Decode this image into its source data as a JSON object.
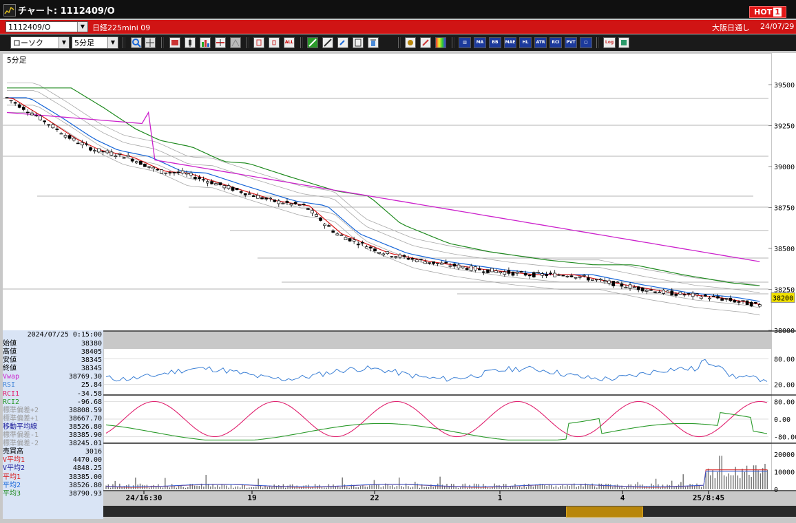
{
  "window": {
    "title": "チャート: 1112409/O",
    "hot_label": "HOT",
    "hot_num": "1"
  },
  "symbolbar": {
    "code": "1112409/O",
    "name": "日経225mini 09",
    "market": "大阪日通し",
    "date": "24/07/29"
  },
  "toolbar": {
    "chart_type": "ローソク",
    "period": "5分足",
    "labels": [
      "MA",
      "BB",
      "MAE",
      "HL",
      "ATR",
      "RCI",
      "PVT",
      "Log"
    ]
  },
  "chart": {
    "period_label": "5分足",
    "price_axis": [
      "39500",
      "39250",
      "39000",
      "38750",
      "38500",
      "38250",
      "38000"
    ],
    "current_price_badge": "38200",
    "rsi_axis": [
      "80.00",
      "20.00"
    ],
    "rci_axis": [
      "80.00",
      "0.00",
      "-80.00"
    ],
    "vol_axis": [
      "20000",
      "10000",
      "0"
    ],
    "x_labels": [
      "24/16:30",
      "19",
      "22",
      "1",
      "4",
      "25/8:45"
    ],
    "colors": {
      "bg": "#ffffff",
      "ma1": "#d81818",
      "ma2": "#1565d8",
      "ma3": "#1f8a1f",
      "vwap": "#cc22cc",
      "band": "#a8a8a8",
      "rsi": "#3a7fd5",
      "rci1": "#e0206e",
      "rci2": "#2a9a2a",
      "vol_bar": "#707070",
      "vol_ma1": "#d81818",
      "vol_ma2": "#2a5ad8"
    }
  },
  "info_panel": {
    "timestamp": "2024/07/25 0:15:00",
    "rows": [
      {
        "label": "始値",
        "value": "38380",
        "color": "#000000"
      },
      {
        "label": "高値",
        "value": "38405",
        "color": "#000000"
      },
      {
        "label": "安値",
        "value": "38345",
        "color": "#000000"
      },
      {
        "label": "終値",
        "value": "38345",
        "color": "#000000"
      },
      {
        "label": "Vwap",
        "value": "38769.30",
        "color": "#cc22cc"
      },
      {
        "label": "RSI",
        "value": "25.84",
        "color": "#4a8ad8"
      },
      {
        "label": "RCI1",
        "value": "-34.58",
        "color": "#e0206e"
      },
      {
        "label": "RCI2",
        "value": "-96.68",
        "color": "#2a9a2a"
      },
      {
        "label": "標準偏差+2",
        "value": "38808.59",
        "color": "#9a9a9a"
      },
      {
        "label": "標準偏差+1",
        "value": "38667.70",
        "color": "#9a9a9a"
      },
      {
        "label": "移動平均線",
        "value": "38526.80",
        "color": "#1a1a9a"
      },
      {
        "label": "標準偏差-1",
        "value": "38385.90",
        "color": "#9a9a9a"
      },
      {
        "label": "標準偏差-2",
        "value": "38245.01",
        "color": "#9a9a9a"
      },
      {
        "label": "売買高",
        "value": "3016",
        "color": "#000000"
      },
      {
        "label": "V平均1",
        "value": "4470.00",
        "color": "#d81818"
      },
      {
        "label": "V平均2",
        "value": "4848.25",
        "color": "#1a1a9a"
      },
      {
        "label": "平均1",
        "value": "38385.00",
        "color": "#d81818"
      },
      {
        "label": "平均2",
        "value": "38526.80",
        "color": "#1565d8"
      },
      {
        "label": "平均3",
        "value": "38790.93",
        "color": "#1f8a1f"
      }
    ]
  }
}
